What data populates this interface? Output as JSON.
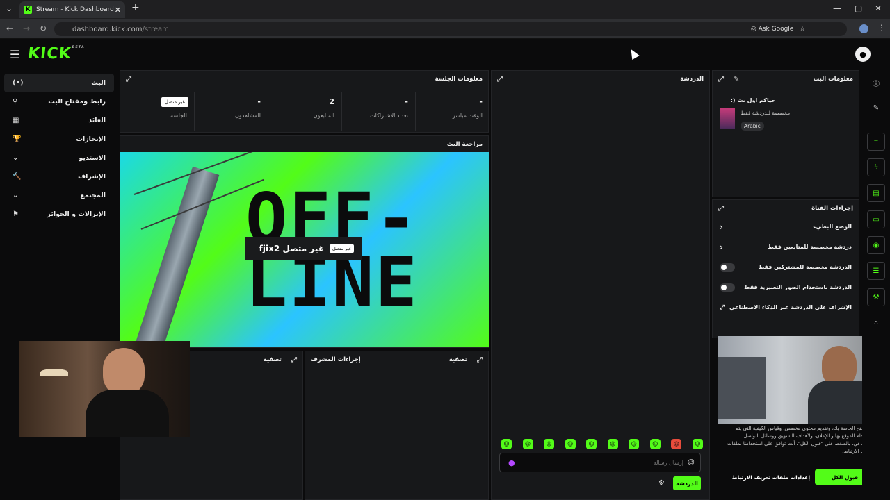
{
  "browser": {
    "tab_title": "Stream - Kick Dashboard",
    "tab_favicon": "K",
    "url_host": "dashboard.kick.com",
    "url_path": "/stream",
    "ask_google": "Ask Google"
  },
  "header": {
    "logo": "KICK",
    "logo_sup": "BETA"
  },
  "sidebar": {
    "items": [
      {
        "label": "البث",
        "icon": "(•)"
      },
      {
        "label": "رابط ومفتاح البث",
        "icon": "⚲"
      },
      {
        "label": "العائد",
        "icon": "▦"
      },
      {
        "label": "الإنجازات",
        "icon": "🏆"
      },
      {
        "label": "الاستديو",
        "icon": "⌄"
      },
      {
        "label": "الإشراف",
        "icon": "🔨"
      },
      {
        "label": "المجتمع",
        "icon": "⌄"
      },
      {
        "label": "الإنزالات و الجوائز",
        "icon": "⚑"
      }
    ]
  },
  "session_info": {
    "title": "معلومات الجلسة",
    "stats": [
      {
        "value": "-",
        "label": "الوقت مباشر"
      },
      {
        "value": "-",
        "label": "تعداد الاشتراكات"
      },
      {
        "value": "2",
        "label": "المتابعون"
      },
      {
        "value": "-",
        "label": "المشاهدون"
      },
      {
        "badge": "غير متصل",
        "label": "الجلسة"
      }
    ]
  },
  "stream_preview": {
    "title": "مراجعة البث",
    "offline_line1": "OFF-",
    "offline_line2": "LINE",
    "channel_name": "fjix2 غير متصل",
    "offline_badge": "غير متصل"
  },
  "chat": {
    "title": "الدردشة",
    "input_placeholder": "إرسال رسالة",
    "send_label": "الدردشة"
  },
  "stream_info": {
    "title": "معلومات البث",
    "stream_title": ":) حياكم اول بث",
    "category": "مخصصة للدردشة فقط",
    "language": "Arabic"
  },
  "channel_actions": {
    "title": "إجراءات القناة",
    "options": [
      {
        "label": "الوضع البطيء",
        "type": "chevron"
      },
      {
        "label": "دردشة مخصصة للمتابعين فقط",
        "type": "chevron"
      },
      {
        "label": "الدردشة مخصصة للمشتركين فقط",
        "type": "toggle"
      },
      {
        "label": "الدردشة باستخدام الصور التعبيرية فقط",
        "type": "toggle"
      },
      {
        "label": "الإشراف على الدردشة عبر الذكاء الاصطناعي",
        "type": "external"
      }
    ]
  },
  "bottom_panels": {
    "filter_left": "تصفية",
    "mod_actions": "إجراءات المشرف",
    "filter_right": "تصفية"
  },
  "cookie": {
    "text": "المتصفح الخاصة بك، وتقديم محتوى مخصص، وقياس الكيفية التي يتم استخدام الموقع بها و للإعلان، ولأهداف التسويق ووسائل التواصل الاجتماعي. بالضغط على \"قبول الكل\"، أنت توافق على استخدامنا لملفات تعريف الارتباط.",
    "accept": "قبول الكل",
    "settings": "إعدادات ملفات تعريف الارتباط"
  },
  "colors": {
    "accent": "#53fc18",
    "bg": "#0b0b0c",
    "panel": "#17181a"
  }
}
